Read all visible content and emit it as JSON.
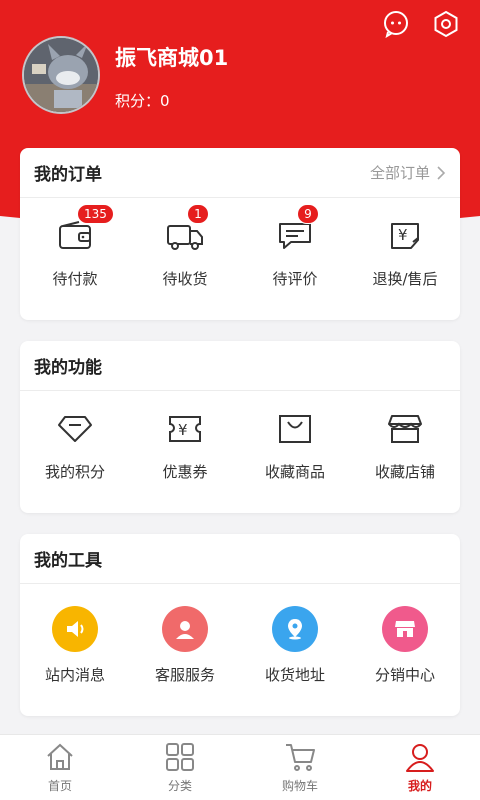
{
  "profile": {
    "username": "振飞商城01",
    "points_label": "积分：",
    "points_value": "0"
  },
  "top_icons": [
    "message-icon",
    "settings-hexagon-icon"
  ],
  "orders": {
    "title": "我的订单",
    "all_orders": "全部订单",
    "items": [
      {
        "label": "待付款",
        "icon": "wallet-icon",
        "badge": "135"
      },
      {
        "label": "待收货",
        "icon": "truck-icon",
        "badge": "1"
      },
      {
        "label": "待评价",
        "icon": "comment-icon",
        "badge": "9"
      },
      {
        "label": "退换/售后",
        "icon": "refund-icon",
        "badge": ""
      }
    ]
  },
  "functions": {
    "title": "我的功能",
    "items": [
      {
        "label": "我的积分",
        "icon": "diamond-icon"
      },
      {
        "label": "优惠券",
        "icon": "coupon-icon"
      },
      {
        "label": "收藏商品",
        "icon": "shopping-bag-icon"
      },
      {
        "label": "收藏店铺",
        "icon": "store-icon"
      }
    ]
  },
  "tools": {
    "title": "我的工具",
    "items": [
      {
        "label": "站内消息",
        "icon": "speaker-icon",
        "color": "#f8b500"
      },
      {
        "label": "客服服务",
        "icon": "customer-service-icon",
        "color": "#f06a6a"
      },
      {
        "label": "收货地址",
        "icon": "location-icon",
        "color": "#3aa5ee"
      },
      {
        "label": "分销中心",
        "icon": "shop-icon",
        "color": "#f05a8c"
      }
    ]
  },
  "tabbar": {
    "items": [
      {
        "label": "首页",
        "icon": "home-icon"
      },
      {
        "label": "分类",
        "icon": "category-icon"
      },
      {
        "label": "购物车",
        "icon": "cart-icon"
      },
      {
        "label": "我的",
        "icon": "user-icon",
        "active": true
      }
    ]
  },
  "colors": {
    "brand_red": "#e61e1e",
    "badge_red": "#e61e1e",
    "active_tab": "#d71d1d"
  }
}
